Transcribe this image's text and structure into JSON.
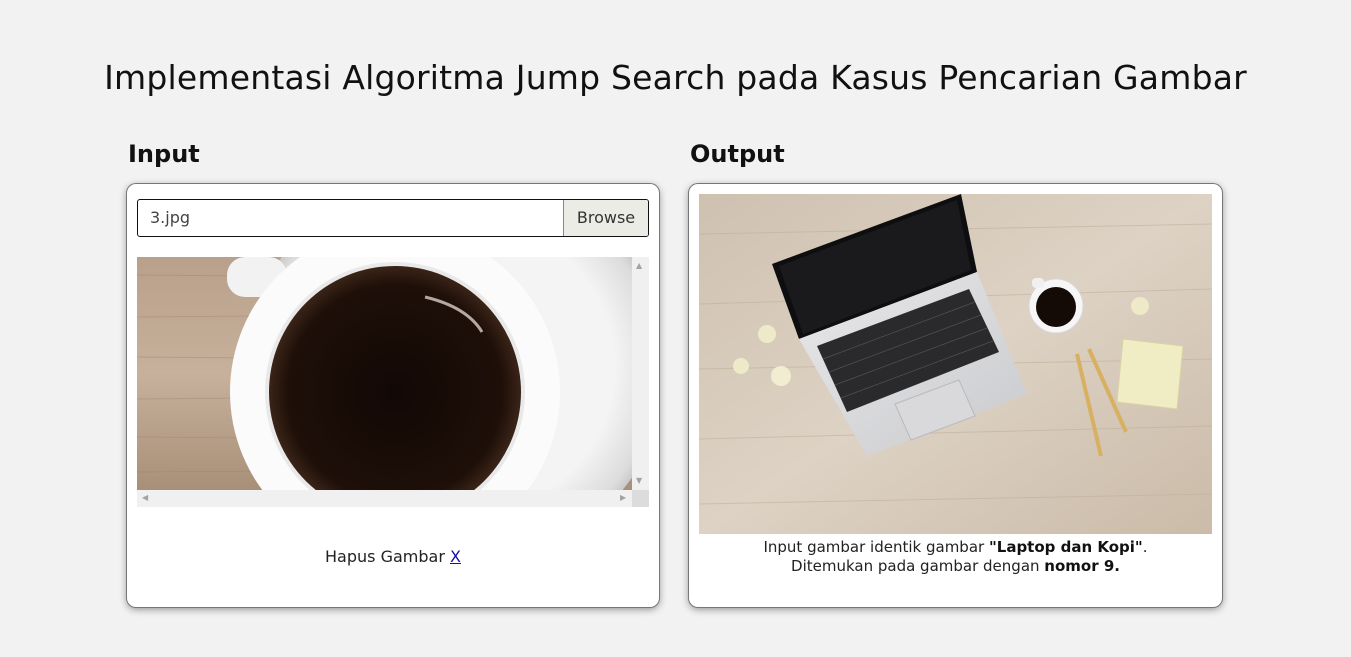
{
  "page": {
    "title": "Implementasi Algoritma Jump Search pada Kasus Pencarian Gambar"
  },
  "input": {
    "label": "Input",
    "file_name": "3.jpg",
    "browse_label": "Browse",
    "remove_label": "Hapus Gambar",
    "remove_link": "X"
  },
  "output": {
    "label": "Output",
    "line1_prefix": "Input gambar identik gambar ",
    "match_name": "\"Laptop dan Kopi\"",
    "line1_suffix": ".",
    "line2_prefix": "Ditemukan pada gambar dengan ",
    "match_number": "nomor 9."
  },
  "icons": {
    "scroll_up": "chevron-up-icon",
    "scroll_down": "chevron-down-icon",
    "scroll_left": "chevron-left-icon",
    "scroll_right": "chevron-right-icon"
  },
  "colors": {
    "background": "#f2f2f2",
    "link": "#1a0dab"
  }
}
